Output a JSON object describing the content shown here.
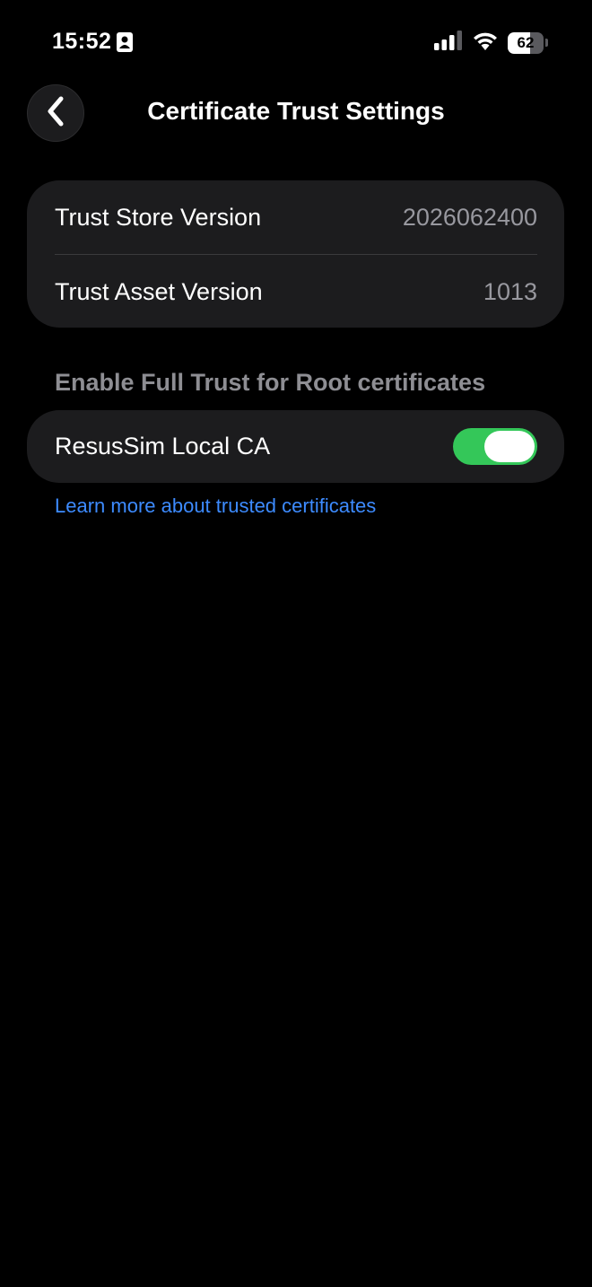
{
  "status_bar": {
    "time": "15:52",
    "contact_icon": "contact-card-icon",
    "signal_icon": "cellular-signal-icon",
    "wifi_icon": "wifi-icon",
    "battery_level": "62",
    "battery_fraction": 0.62
  },
  "nav": {
    "back_icon": "chevron-left-icon",
    "title": "Certificate Trust Settings"
  },
  "info": {
    "rows": [
      {
        "label": "Trust Store Version",
        "value": "2026062400"
      },
      {
        "label": "Trust Asset Version",
        "value": "1013"
      }
    ]
  },
  "full_trust": {
    "header": "Enable Full Trust for Root certificates",
    "certificates": [
      {
        "name": "ResusSim Local CA",
        "enabled": true
      }
    ],
    "learn_more_link": "Learn more about trusted certificates"
  },
  "colors": {
    "background": "#000000",
    "group_background": "#1c1c1e",
    "toggle_on": "#34c759",
    "link": "#3d8bff",
    "secondary_text": "#98989f"
  }
}
